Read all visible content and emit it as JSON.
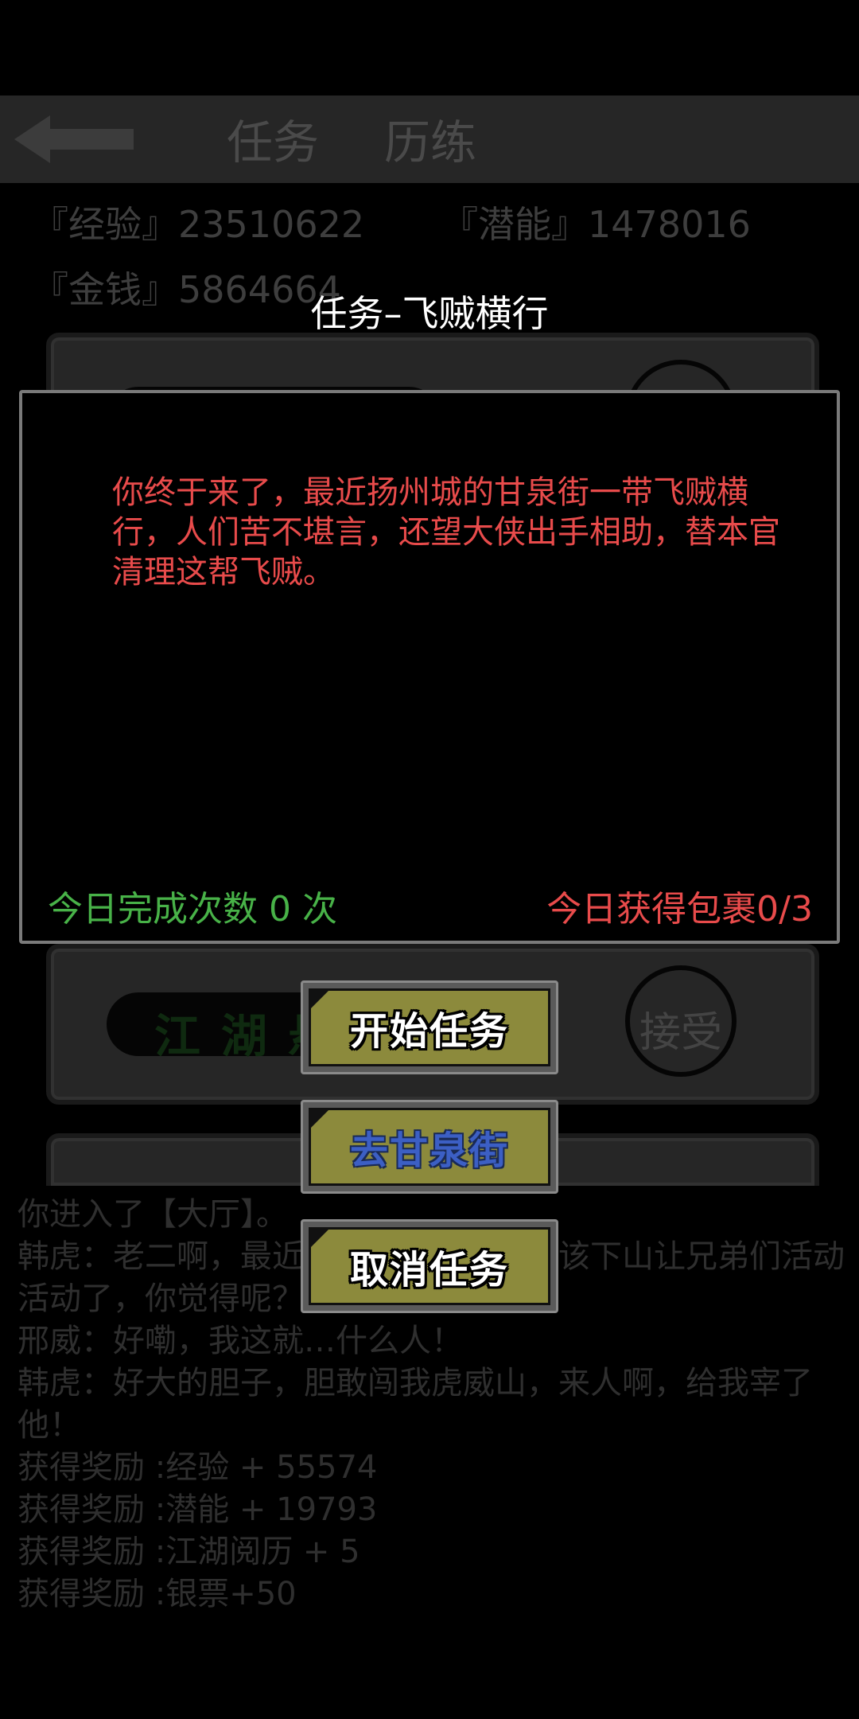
{
  "background": {
    "tabs": [
      "任务",
      "历练"
    ],
    "stats": {
      "exp": "『经验』23510622",
      "potential": "『潜能』1478016",
      "money": "『金钱』5864664"
    },
    "card": {
      "banner": "江湖悬赏",
      "accept": "接受"
    },
    "log": [
      "你进入了【大厅】。",
      "韩虎：老二啊，最近好久没有活动啊，该下山让兄弟们活动活动了，你觉得呢？",
      "邢威：好嘞，我这就…什么人！",
      "韩虎：好大的胆子，胆敢闯我虎威山，来人啊，给我宰了他！",
      "获得奖励 :经验 + 55574",
      "获得奖励 :潜能 + 19793",
      "获得奖励 :江湖阅历 + 5",
      "获得奖励 :银票+50"
    ]
  },
  "modal": {
    "title": "任务–飞贼横行",
    "description": "你终于来了，最近扬州城的甘泉街一带飞贼横行，人们苦不堪言，还望大侠出手相助，替本官清理这帮飞贼。",
    "daily_count": "今日完成次数 0 次",
    "daily_parcel": "今日获得包裹0/3"
  },
  "buttons": {
    "start": "开始任务",
    "goto": "去甘泉街",
    "cancel": "取消任务"
  },
  "colors": {
    "description": "#e84b4b",
    "count": "#48b248",
    "button_face": "#8c8a3c",
    "goto_label": "#3c5fc4"
  }
}
